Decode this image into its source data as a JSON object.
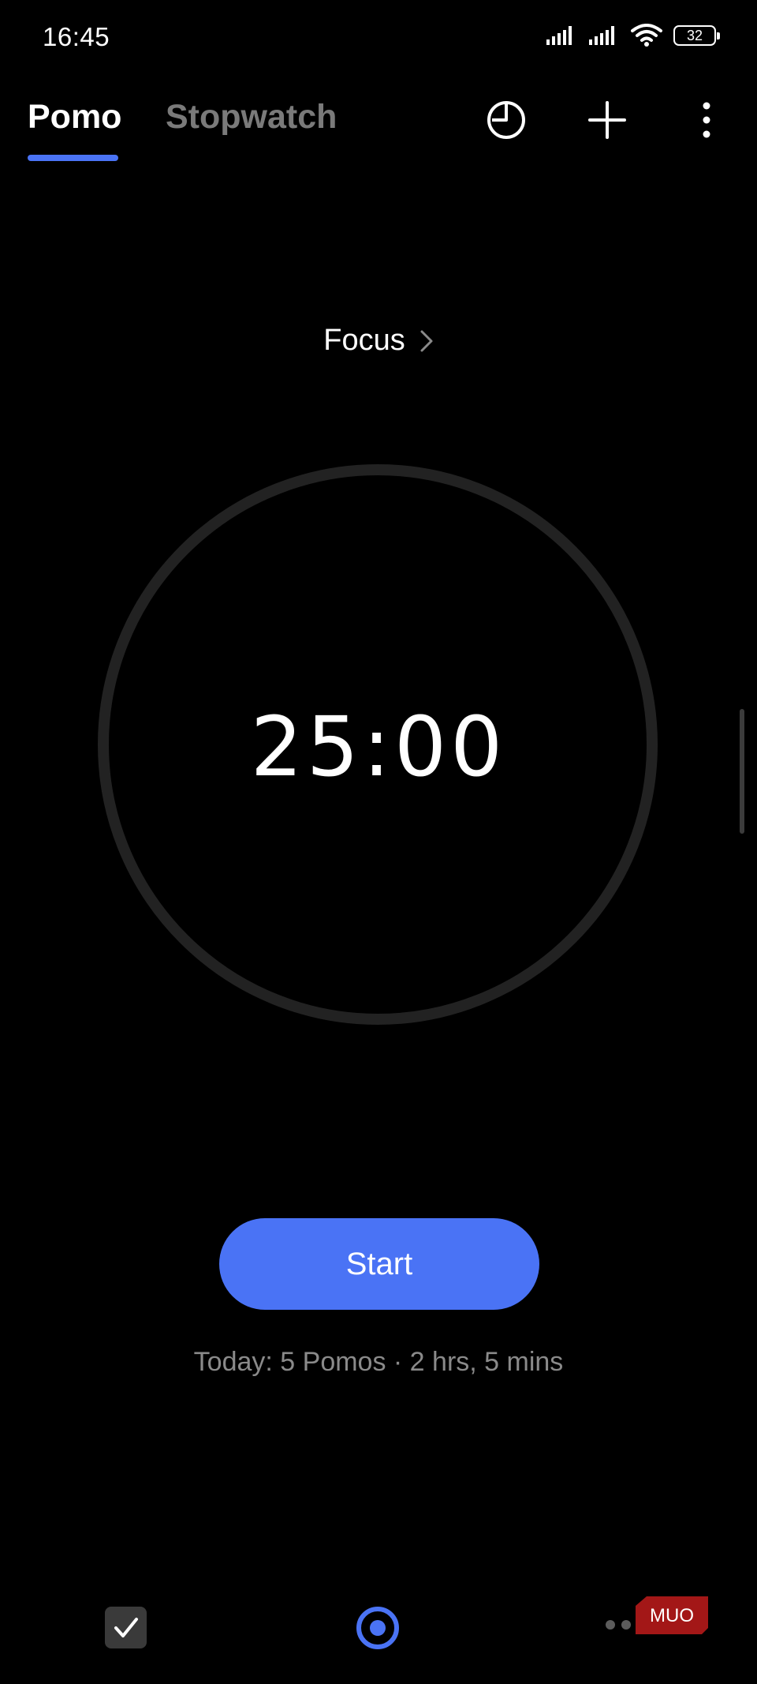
{
  "status_bar": {
    "time": "16:45",
    "battery_level": "32",
    "icons": [
      "signal-icon",
      "signal-icon",
      "wifi-icon",
      "battery-icon"
    ]
  },
  "header": {
    "tabs": [
      {
        "label": "Pomo",
        "active": true
      },
      {
        "label": "Stopwatch",
        "active": false
      }
    ],
    "actions": [
      "statistics-icon",
      "add-icon",
      "more-options-icon"
    ]
  },
  "timer": {
    "mode_label": "Focus",
    "time_remaining": "25:00",
    "progress": 0
  },
  "controls": {
    "start_label": "Start"
  },
  "summary": {
    "today_text": "Today: 5 Pomos · 2 hrs, 5 mins"
  },
  "bottom_nav": {
    "items": [
      "task-checkbox-icon",
      "pomo-focus-icon",
      "more-dots-icon"
    ]
  },
  "watermark": {
    "text": "MUO"
  },
  "colors": {
    "accent": "#4a73f5",
    "background": "#000000",
    "ring": "#222222",
    "inactive_tab": "#7a7a7a",
    "secondary_text": "#8a8a8a"
  }
}
